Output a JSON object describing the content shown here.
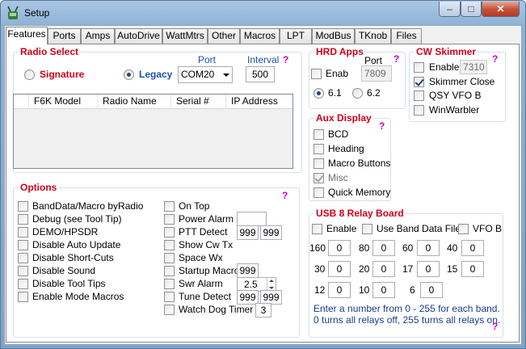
{
  "window": {
    "title": "Setup",
    "icon": "radio-app-icon",
    "minimize": "–",
    "maximize": "□",
    "close": "✕"
  },
  "tabs": [
    {
      "label": "Features",
      "active": true
    },
    {
      "label": "Ports"
    },
    {
      "label": "Amps"
    },
    {
      "label": "AutoDrive"
    },
    {
      "label": "WattMtrs"
    },
    {
      "label": "Other"
    },
    {
      "label": "Macros"
    },
    {
      "label": "LPT"
    },
    {
      "label": "ModBus"
    },
    {
      "label": "TKnob"
    },
    {
      "label": "Files"
    }
  ],
  "radio_select": {
    "title": "Radio Select",
    "help": "?",
    "signature_label": "Signature",
    "signature_checked": false,
    "legacy_label": "Legacy",
    "legacy_checked": true,
    "port_label": "Port",
    "port_value": "COM20",
    "interval_label": "Interval",
    "interval_value": "500",
    "columns": [
      "F6K Model",
      "Radio Name",
      "Serial #",
      "IP Address"
    ]
  },
  "hrd_apps": {
    "title": "HRD Apps",
    "help": "?",
    "port_label": "Port",
    "enab_label": "Enab",
    "enab_checked": false,
    "port_value": "7809",
    "v61_label": "6.1",
    "v61_checked": true,
    "v62_label": "6.2",
    "v62_checked": false
  },
  "cw_skimmer": {
    "title": "CW Skimmer",
    "help": "?",
    "enable_label": "Enable",
    "enable_checked": false,
    "enable_value": "7310",
    "skimmer_close_label": "Skimmer Close",
    "skimmer_close_checked": true,
    "qsy_label": "QSY VFO B",
    "qsy_checked": false,
    "winwarbler_label": "WinWarbler",
    "winwarbler_checked": false
  },
  "aux_display": {
    "title": "Aux Display",
    "help": "?",
    "items": [
      {
        "label": "BCD",
        "checked": false,
        "disabled": false
      },
      {
        "label": "Heading",
        "checked": false,
        "disabled": false
      },
      {
        "label": "Macro Buttons",
        "checked": false,
        "disabled": false
      },
      {
        "label": "Misc",
        "checked": true,
        "disabled": true
      },
      {
        "label": "Quick Memory",
        "checked": false,
        "disabled": false
      }
    ]
  },
  "options": {
    "title": "Options",
    "help": "?",
    "left": [
      {
        "label": "BandData/Macro byRadio",
        "checked": false
      },
      {
        "label": "Debug (see Tool Tip)",
        "checked": false
      },
      {
        "label": "DEMO/HPSDR",
        "checked": false
      },
      {
        "label": "Disable Auto Update",
        "checked": false
      },
      {
        "label": "Disable Short-Cuts",
        "checked": false
      },
      {
        "label": "Disable Sound",
        "checked": false
      },
      {
        "label": "Disable Tool Tips",
        "checked": false
      },
      {
        "label": "Enable Mode Macros",
        "checked": false
      }
    ],
    "right": [
      {
        "label": "On Top",
        "checked": false
      },
      {
        "label": "Power Alarm",
        "checked": false
      },
      {
        "label": "PTT Detect",
        "checked": false
      },
      {
        "label": "Show Cw Tx",
        "checked": false
      },
      {
        "label": "Space Wx",
        "checked": false
      },
      {
        "label": "Startup Macro",
        "checked": false
      },
      {
        "label": "Swr Alarm",
        "checked": false
      },
      {
        "label": "Tune Detect",
        "checked": false
      },
      {
        "label": "Watch Dog Timer",
        "checked": false
      }
    ],
    "power_alarm_value": "",
    "ptt_value1": "999",
    "ptt_value2": "999",
    "startup_macro_value": "999",
    "swr_value": "2.5",
    "tune_value1": "999",
    "tune_value2": "999",
    "watchdog_value": "3"
  },
  "usb_relay": {
    "title": "USB 8 Relay Board",
    "help": "?",
    "enable_label": "Enable",
    "enable_checked": false,
    "use_band_label": "Use Band Data File",
    "use_band_checked": false,
    "vfob_label": "VFO B",
    "vfob_checked": false,
    "bands": [
      {
        "band": "160",
        "value": "0"
      },
      {
        "band": "80",
        "value": "0"
      },
      {
        "band": "60",
        "value": "0"
      },
      {
        "band": "40",
        "value": "0"
      },
      {
        "band": "30",
        "value": "0"
      },
      {
        "band": "20",
        "value": "0"
      },
      {
        "band": "17",
        "value": "0"
      },
      {
        "band": "15",
        "value": "0"
      },
      {
        "band": "12",
        "value": "0"
      },
      {
        "band": "10",
        "value": "0"
      },
      {
        "band": "6",
        "value": "0"
      }
    ],
    "note1": "Enter a number from 0 - 255 for each band.",
    "note2": "0 turns all relays off, 255 turns all relays on."
  }
}
